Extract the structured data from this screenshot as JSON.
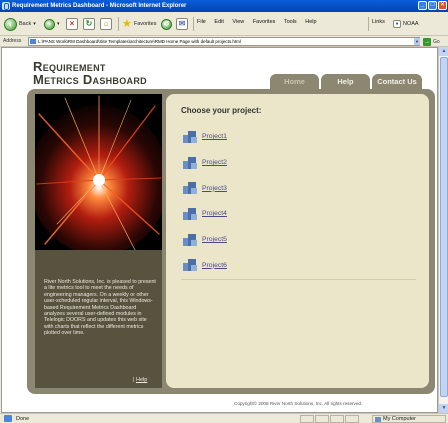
{
  "window": {
    "title": "Requirement Metrics Dashboard - Microsoft Internet Explorer",
    "controls": [
      "_",
      "□",
      "×"
    ]
  },
  "toolbar": {
    "back_label": "Back",
    "favorites_label": "Favorites",
    "menu": [
      "File",
      "Edit",
      "View",
      "Favorites",
      "Tools",
      "Help"
    ],
    "links_label": "Links",
    "noaa_label": "NOAA"
  },
  "address": {
    "label": "Address",
    "url": "L:\\PANS Work\\RM Dashboard\\Site Templates\\architecture\\RMD Home Page with default projects.html",
    "go_label": "Go"
  },
  "site": {
    "title_line1": "Requirement",
    "title_line2": "Metrics Dashboard",
    "tabs": [
      {
        "label": "Home",
        "active": true
      },
      {
        "label": "Help",
        "active": false
      },
      {
        "label": "Contact Us",
        "active": false
      }
    ],
    "blurb": "River North Solutions, Inc. is pleased to present a lite metrics tool to meet the needs of engineering managers. On a weekly or other user-scheduled regular interval, this Windows-based Requirement Metrics Dashboard analyzes several user-defined modules in Telelogic DOORS and updates this web site with charts that reflect the different metrics plotted over time.",
    "left_help_prefix": "|",
    "left_help_link": "Help",
    "choose_label": "Choose your project:",
    "projects": [
      "Project1",
      "Project2",
      "Project3",
      "Project4",
      "Project5",
      "Project6"
    ],
    "copyright": "Copyright© 2008 River North Solutions, Inc. All rights reserved."
  },
  "statusbar": {
    "text": "Done",
    "zone": "My Computer"
  },
  "colors": {
    "title_bar": "#0342b4",
    "frame": "#8c8771",
    "left_column": "#57533f",
    "content_panel": "#ebe6c9",
    "link": "#4a4a80"
  }
}
